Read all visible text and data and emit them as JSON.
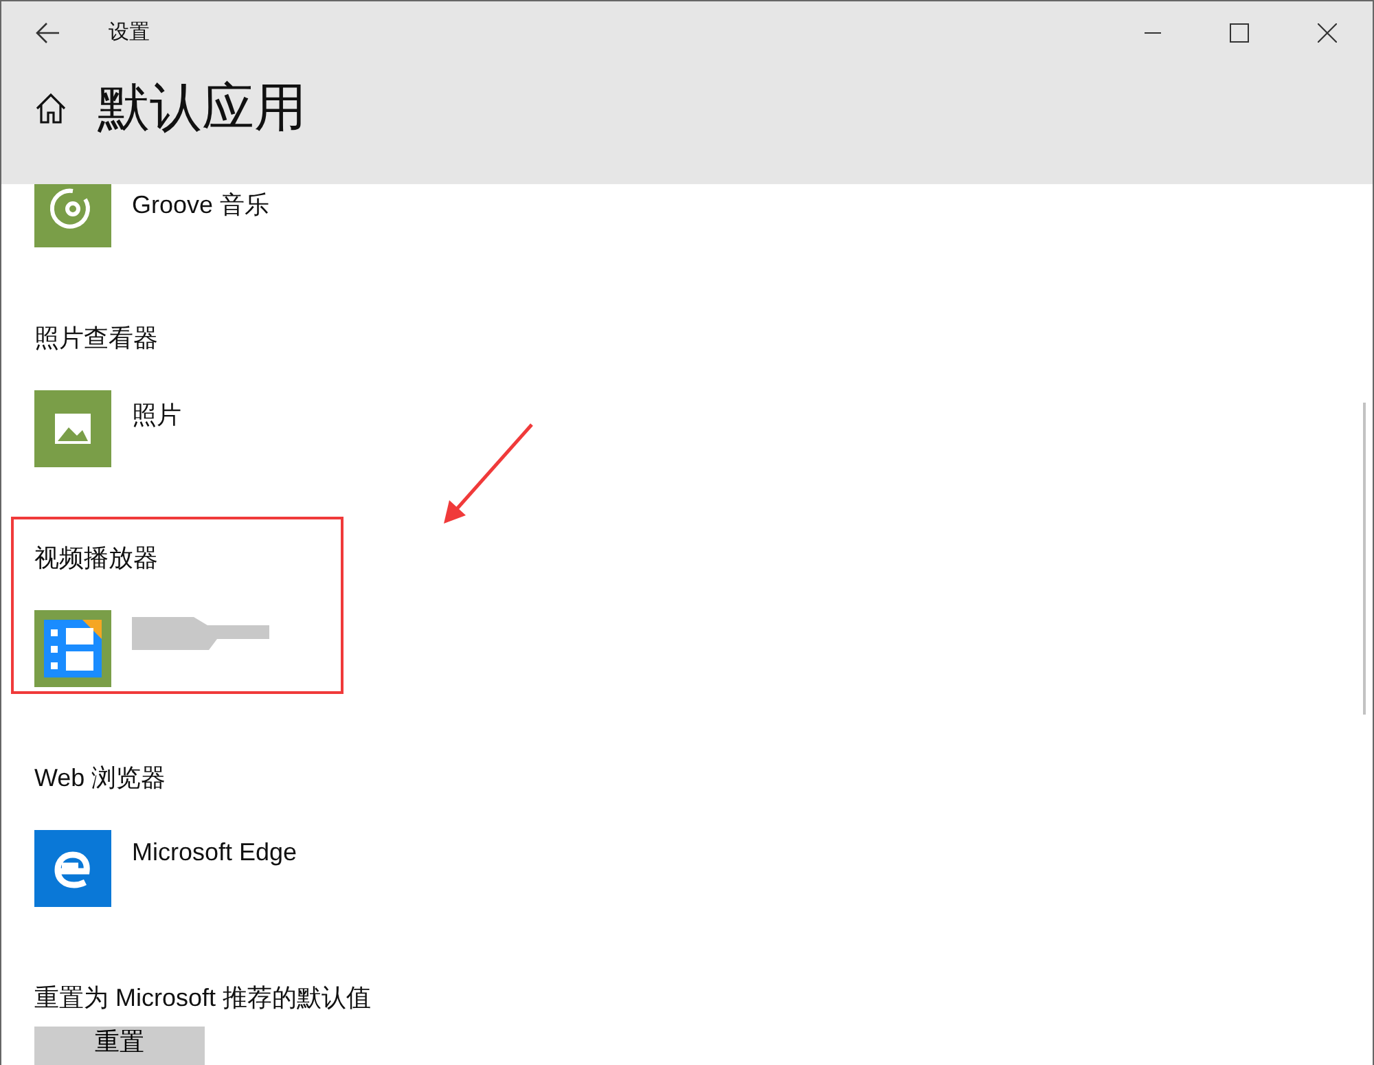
{
  "window": {
    "title": "设置"
  },
  "page": {
    "title": "默认应用"
  },
  "sections": [
    {
      "highlighted": false,
      "app": {
        "kind": "groove",
        "name": "Groove 音乐"
      }
    },
    {
      "label": "照片查看器",
      "highlighted": false,
      "app": {
        "kind": "photos",
        "name": "照片"
      }
    },
    {
      "label": "视频播放器",
      "highlighted": true,
      "app": {
        "kind": "video",
        "redacted": true
      }
    },
    {
      "label": "Web 浏览器",
      "highlighted": false,
      "app": {
        "kind": "edge",
        "name": "Microsoft Edge"
      }
    }
  ],
  "reset": {
    "label": "重置为 Microsoft 推荐的默认值",
    "button": "重置"
  }
}
